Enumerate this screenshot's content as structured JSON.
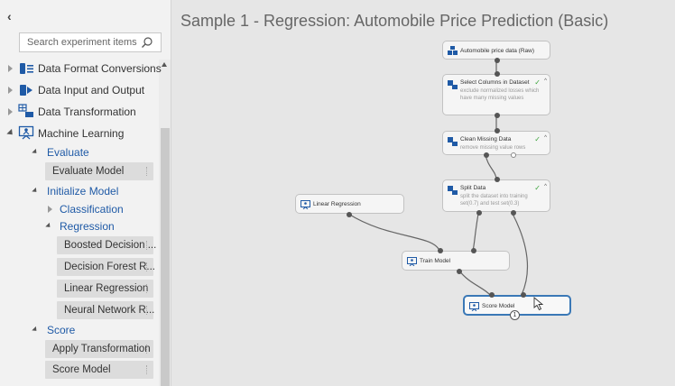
{
  "sidebar": {
    "collapse_glyph": "‹",
    "search_placeholder": "Search experiment items",
    "categories": [
      {
        "label": "Data Format Conversions",
        "icon": "data-format-icon"
      },
      {
        "label": "Data Input and Output",
        "icon": "data-io-icon"
      },
      {
        "label": "Data Transformation",
        "icon": "data-transform-icon"
      },
      {
        "label": "Machine Learning",
        "icon": "machine-learning-icon"
      }
    ],
    "evaluate": {
      "label": "Evaluate",
      "items": [
        "Evaluate Model"
      ]
    },
    "initialize": {
      "label": "Initialize Model",
      "classification": "Classification",
      "regression": {
        "label": "Regression",
        "items": [
          "Boosted Decision ...",
          "Decision Forest R...",
          "Linear Regression",
          "Neural Network R..."
        ]
      }
    },
    "score": {
      "label": "Score",
      "items": [
        "Apply Transformation",
        "Score Model"
      ]
    }
  },
  "canvas": {
    "title": "Sample 1 - Regression: Automobile Price Prediction (Basic)",
    "modules": {
      "raw_data": {
        "title": "Automobile price data (Raw)",
        "desc": ""
      },
      "select_columns": {
        "title": "Select Columns in Dataset",
        "desc": "exclude normalized losses which have many missing values"
      },
      "clean_missing": {
        "title": "Clean Missing Data",
        "desc": "remove missing value rows"
      },
      "split_data": {
        "title": "Split Data",
        "desc": "split the dataset into training set(0.7) and test set(0.3)"
      },
      "linear_regression": {
        "title": "Linear Regression",
        "desc": ""
      },
      "train_model": {
        "title": "Train Model",
        "desc": ""
      },
      "score_model": {
        "title": "Score Model",
        "desc": ""
      }
    },
    "check_glyph": "✓",
    "caret_glyph": "^",
    "badge": "1"
  },
  "colors": {
    "accent": "#1f5aa6",
    "selected_border": "#3a78b6",
    "check": "#3aa33a"
  }
}
